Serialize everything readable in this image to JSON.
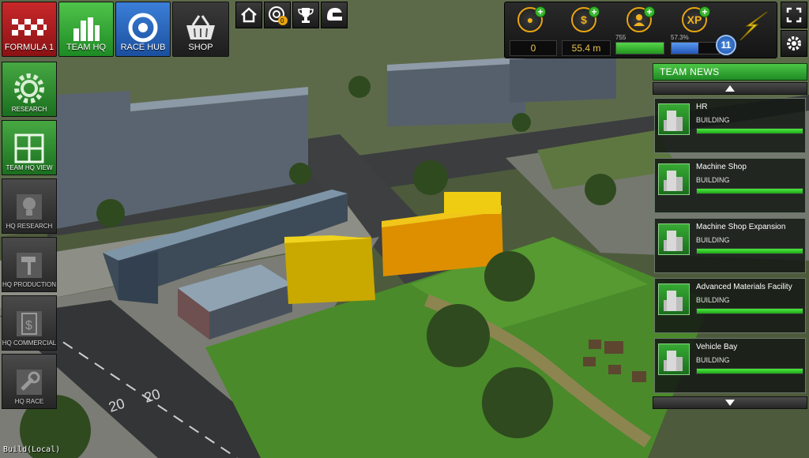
{
  "top_nav": {
    "formula": {
      "label": "FORMULA 1"
    },
    "team_hq": {
      "label": "TEAM HQ"
    },
    "race_hub": {
      "label": "RACE HUB"
    },
    "shop": {
      "label": "SHOP"
    }
  },
  "mini_buttons": [
    {
      "name": "home-icon"
    },
    {
      "name": "target-icon",
      "badge": "0"
    },
    {
      "name": "trophy-icon"
    },
    {
      "name": "helmet-icon"
    }
  ],
  "resources": {
    "tokens": {
      "value": "0",
      "icon": "token-icon"
    },
    "money": {
      "value": "55.4 m",
      "icon": "dollar-icon"
    },
    "staff": {
      "value": "755",
      "icon": "staff-icon",
      "fill": 1.0
    },
    "xp": {
      "label": "XP",
      "percent_text": "57.3%",
      "fill": 0.573,
      "level": "11"
    }
  },
  "side_nav": [
    {
      "label": "RESEARCH",
      "icon": "gear-icon",
      "active": true
    },
    {
      "label": "TEAM HQ VIEW",
      "icon": "grid-icon",
      "active": true
    },
    {
      "label": "HQ RESEARCH",
      "icon": "lightbulb-icon",
      "active": false
    },
    {
      "label": "HQ PRODUCTION",
      "icon": "hammer-icon",
      "active": false
    },
    {
      "label": "HQ COMMERCIAL",
      "icon": "dollar-doc-icon",
      "active": false
    },
    {
      "label": "HQ RACE",
      "icon": "wrench-icon",
      "active": false
    }
  ],
  "team_news": {
    "header": "TEAM NEWS",
    "items": [
      {
        "title": "HR",
        "status": "BUILDING",
        "progress": 1.0
      },
      {
        "title": "Machine Shop",
        "status": "BUILDING",
        "progress": 1.0
      },
      {
        "title": "Machine Shop Expansion",
        "status": "BUILDING",
        "progress": 1.0
      },
      {
        "title": "Advanced Materials Facility",
        "status": "BUILDING",
        "progress": 1.0
      },
      {
        "title": "Vehicle Bay",
        "status": "BUILDING",
        "progress": 1.0
      }
    ]
  },
  "road_marking": "20",
  "build_label": "Build(Local)",
  "colors": {
    "accent_green": "#3fbf3a",
    "gold": "#e8a511",
    "xp_blue": "#2f6fd0"
  }
}
